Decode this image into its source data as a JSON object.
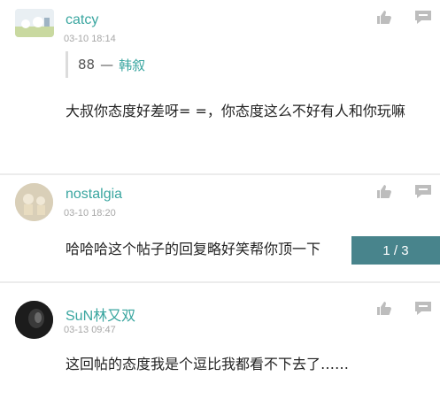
{
  "posts": [
    {
      "username": "catcy",
      "timestamp": "03-10 18:14",
      "quote": {
        "number": "88",
        "dash": "—",
        "name": "韩叙"
      },
      "content": "大叔你态度好差呀= =，你态度这么不好有人和你玩嘛",
      "icons": [
        "thumbs-up-icon",
        "reply-icon"
      ]
    },
    {
      "username": "nostalgia",
      "timestamp": "03-10 18:20",
      "content": "哈哈哈这个帖子的回复略好笑帮你顶一下",
      "icons": [
        "thumbs-up-icon",
        "reply-icon"
      ]
    },
    {
      "username": "SuN林又双",
      "timestamp": "03-13 09:47",
      "content": "这回帖的态度我是个逗比我都看不下去了……",
      "icons": [
        "thumbs-up-icon",
        "reply-icon"
      ]
    }
  ],
  "pager": {
    "label": "1 / 3"
  },
  "colors": {
    "username": "#3aa6a0",
    "timestamp": "#a7a7a7",
    "pager_bg": "#286e78"
  }
}
